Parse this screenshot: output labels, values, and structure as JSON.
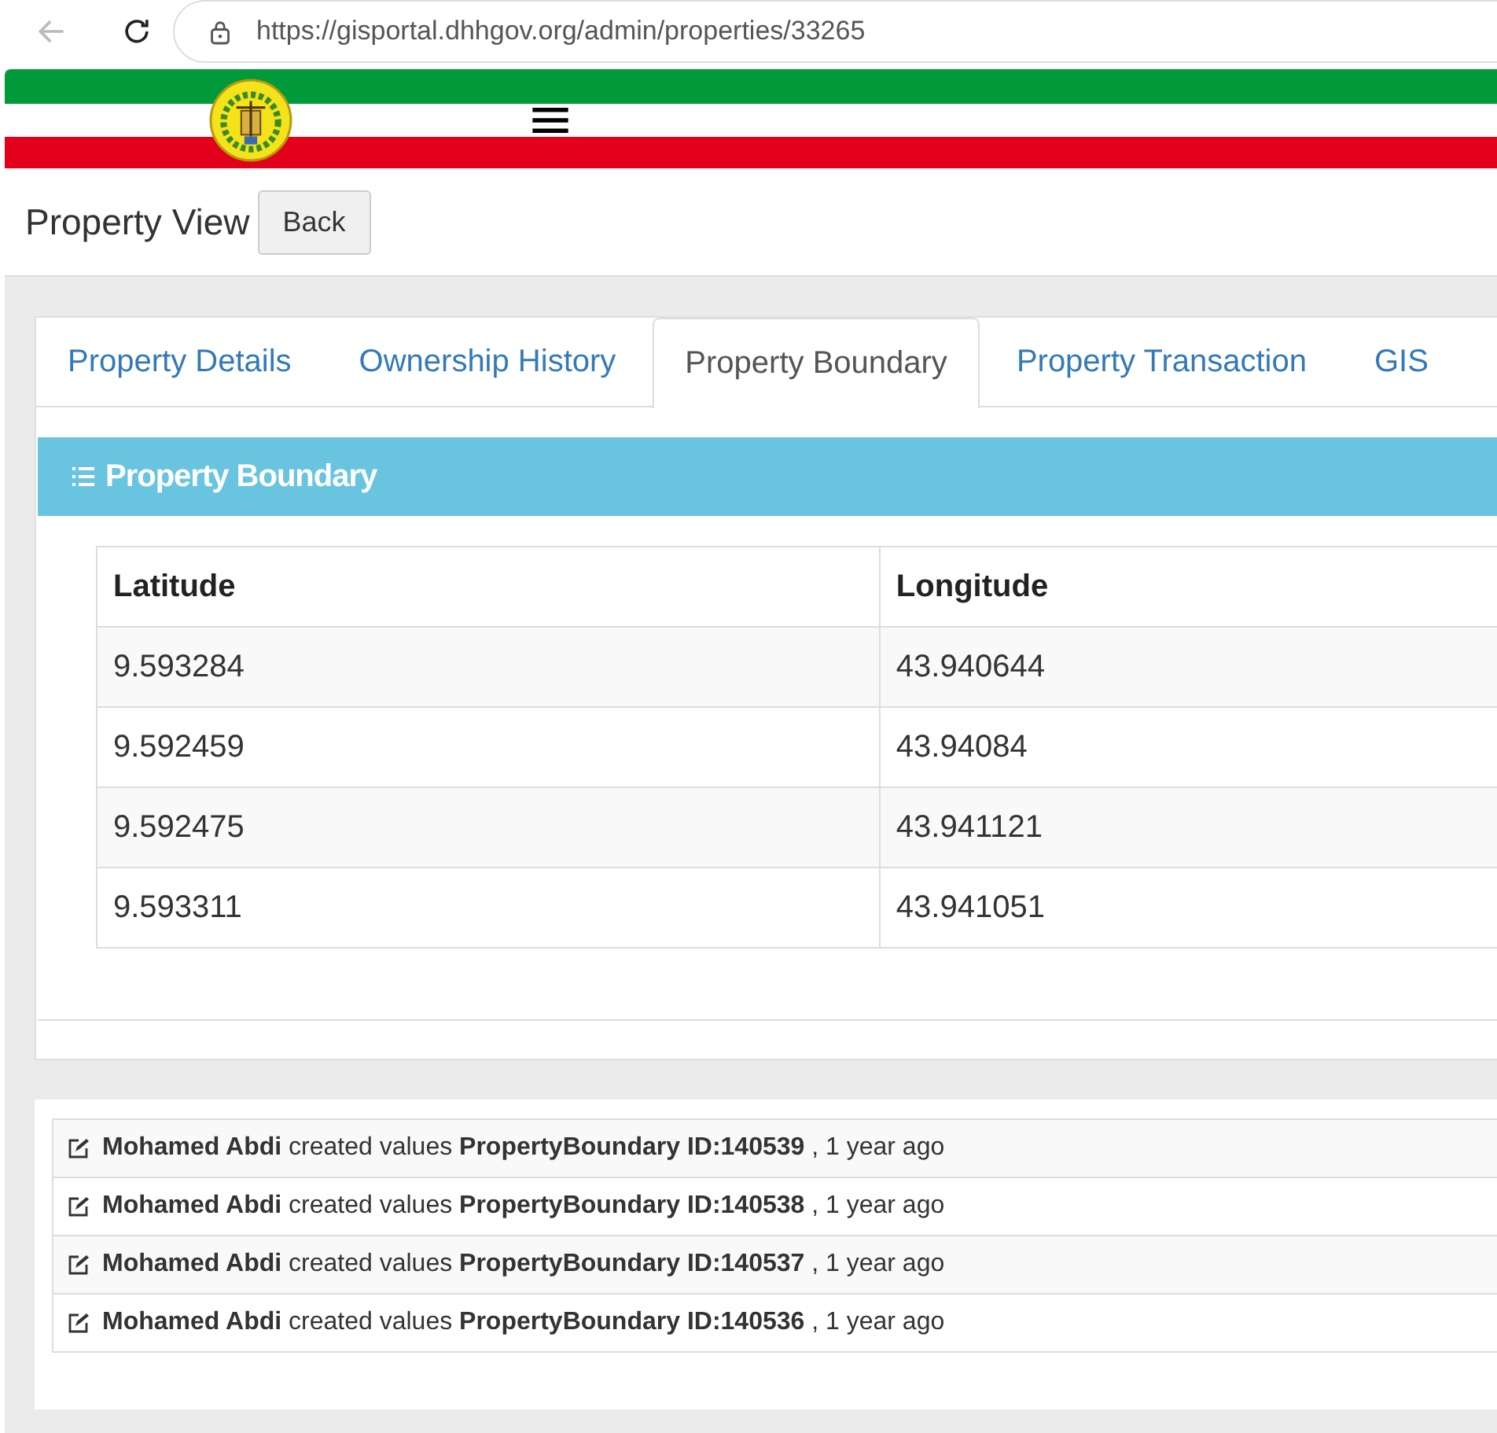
{
  "browser": {
    "url": "https://gisportal.dhhgov.org/admin/properties/33265"
  },
  "page": {
    "title": "Property View",
    "back_button": "Back"
  },
  "tabs": [
    {
      "label": "Property Details",
      "selected": false
    },
    {
      "label": "Ownership History",
      "selected": false
    },
    {
      "label": "Property Boundary",
      "selected": true
    },
    {
      "label": "Property Transaction",
      "selected": false
    },
    {
      "label": "GIS",
      "selected": false
    }
  ],
  "panel": {
    "title": "Property Boundary",
    "table": {
      "columns": [
        "Latitude",
        "Longitude"
      ],
      "rows": [
        [
          "9.593284",
          "43.940644"
        ],
        [
          "9.592459",
          "43.94084"
        ],
        [
          "9.592475",
          "43.941121"
        ],
        [
          "9.593311",
          "43.941051"
        ]
      ]
    }
  },
  "activity_log": [
    "**Mohamed Abdi** created values **PropertyBoundary ID:140539** , 1 year ago",
    "**Mohamed Abdi** created values **PropertyBoundary ID:140538** , 1 year ago",
    "**Mohamed Abdi** created values **PropertyBoundary ID:140537** , 1 year ago",
    "**Mohamed Abdi** created values **PropertyBoundary ID:140536** , 1 year ago"
  ]
}
